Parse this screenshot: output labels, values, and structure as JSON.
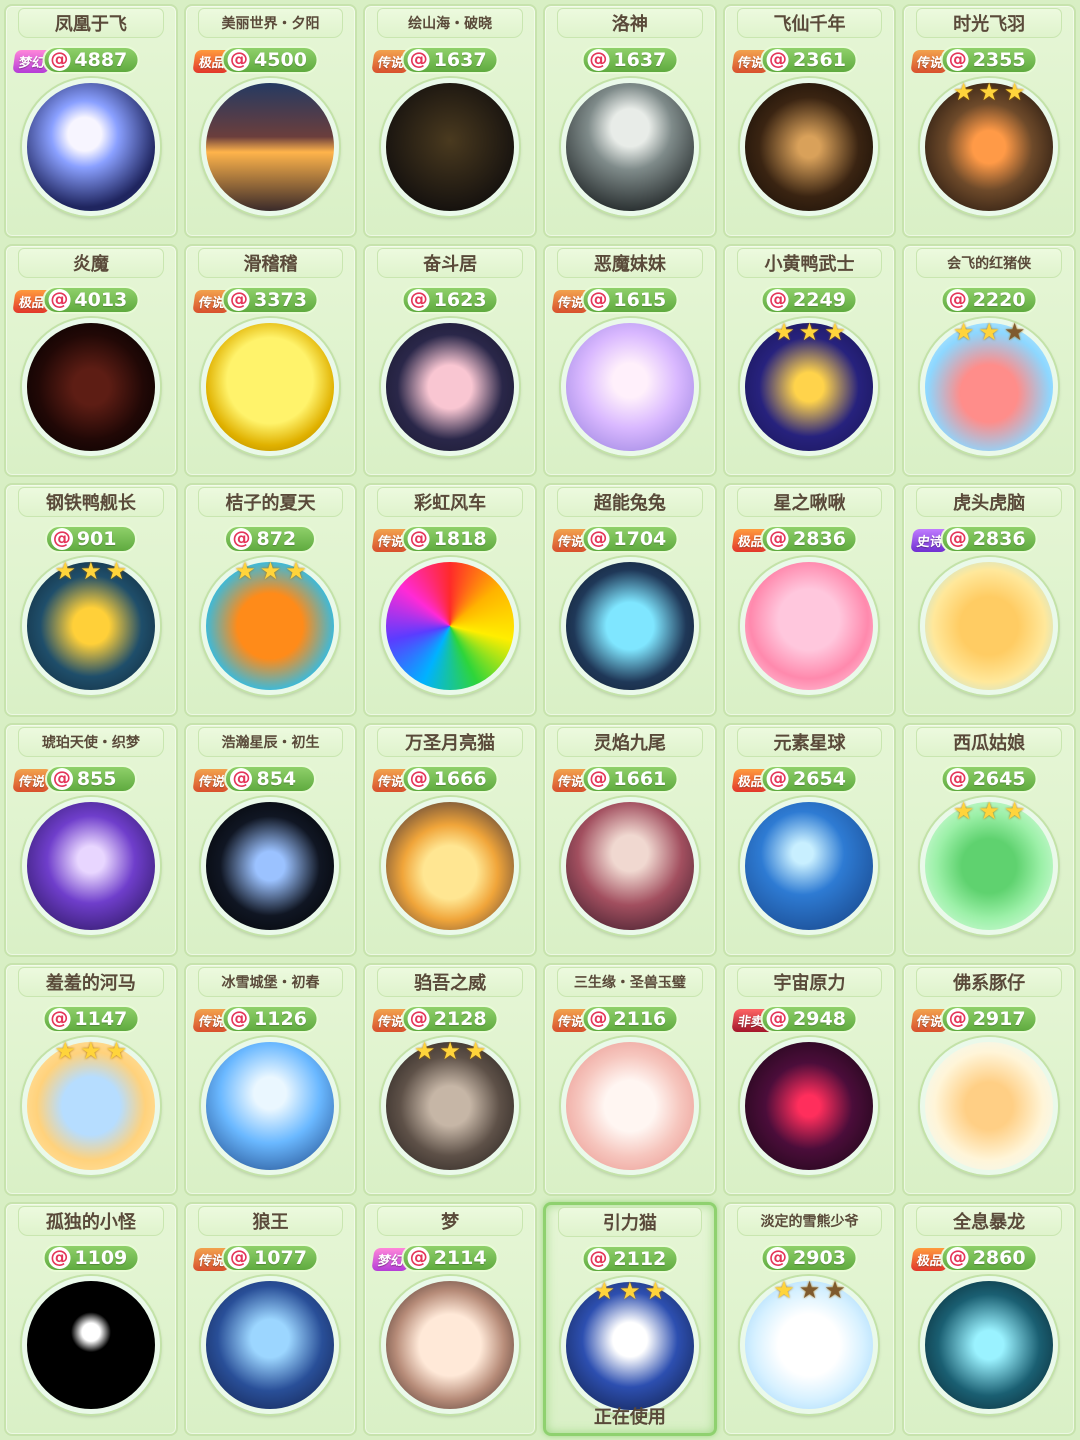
{
  "cards": [
    {
      "name": "凤凰于飞",
      "price": "4887",
      "rank": "梦幻",
      "rank_type": "dream",
      "stars": 0,
      "art": "phoenix"
    },
    {
      "name": "美丽世界・夕阳",
      "price": "4500",
      "rank": "极品",
      "rank_type": "ultra",
      "stars": 0,
      "art": "sunset"
    },
    {
      "name": "绘山海・破晓",
      "price": "1637",
      "rank": "传说",
      "rank_type": "legend",
      "stars": 0,
      "art": "mountain"
    },
    {
      "name": "洛神",
      "price": "1637",
      "rank": "",
      "rank_type": "",
      "stars": 0,
      "art": "goddess"
    },
    {
      "name": "飞仙千年",
      "price": "2361",
      "rank": "传说",
      "rank_type": "legend",
      "stars": 0,
      "art": "fairy"
    },
    {
      "name": "时光飞羽",
      "price": "2355",
      "rank": "传说",
      "rank_type": "legend",
      "stars": 3,
      "art": "owl"
    },
    {
      "name": "炎魔",
      "price": "4013",
      "rank": "极品",
      "rank_type": "ultra",
      "stars": 0,
      "art": "flame"
    },
    {
      "name": "滑稽稽",
      "price": "3373",
      "rank": "传说",
      "rank_type": "legend",
      "stars": 0,
      "art": "emoji"
    },
    {
      "name": "奋斗居",
      "price": "1623",
      "rank": "",
      "rank_type": "",
      "stars": 0,
      "art": "pig-study"
    },
    {
      "name": "恶魔妹妹",
      "price": "1615",
      "rank": "传说",
      "rank_type": "legend",
      "stars": 0,
      "art": "demon-girl"
    },
    {
      "name": "小黄鸭武士",
      "price": "2249",
      "rank": "",
      "rank_type": "",
      "stars": 3,
      "art": "duck-ninja"
    },
    {
      "name": "会飞的红猪侠",
      "price": "2220",
      "rank": "",
      "rank_type": "",
      "stars": 3,
      "stars_dim": 1,
      "art": "red-pig"
    },
    {
      "name": "钢铁鸭舰长",
      "price": "901",
      "rank": "",
      "rank_type": "",
      "stars": 3,
      "art": "iron-duck"
    },
    {
      "name": "桔子的夏天",
      "price": "872",
      "rank": "",
      "rank_type": "",
      "stars": 3,
      "art": "orange"
    },
    {
      "name": "彩虹风车",
      "price": "1818",
      "rank": "传说",
      "rank_type": "legend",
      "stars": 0,
      "art": "rainbow"
    },
    {
      "name": "超能兔兔",
      "price": "1704",
      "rank": "传说",
      "rank_type": "legend",
      "stars": 0,
      "art": "bunny"
    },
    {
      "name": "星之啾啾",
      "price": "2836",
      "rank": "极品",
      "rank_type": "ultra",
      "stars": 0,
      "art": "pink-blob"
    },
    {
      "name": "虎头虎脑",
      "price": "2836",
      "rank": "史诗",
      "rank_type": "epic",
      "stars": 0,
      "art": "tiger"
    },
    {
      "name": "琥珀天使・织梦",
      "price": "855",
      "rank": "传说",
      "rank_type": "legend",
      "stars": 0,
      "art": "galaxy-angel"
    },
    {
      "name": "浩瀚星辰・初生",
      "price": "854",
      "rank": "传说",
      "rank_type": "legend",
      "stars": 0,
      "art": "saturn"
    },
    {
      "name": "万圣月亮猫",
      "price": "1666",
      "rank": "传说",
      "rank_type": "legend",
      "stars": 0,
      "art": "moon-cat"
    },
    {
      "name": "灵焰九尾",
      "price": "1661",
      "rank": "传说",
      "rank_type": "legend",
      "stars": 0,
      "art": "nine-tail"
    },
    {
      "name": "元素星球",
      "price": "2654",
      "rank": "极品",
      "rank_type": "ultra",
      "stars": 0,
      "art": "ocean"
    },
    {
      "name": "西瓜姑娘",
      "price": "2645",
      "rank": "",
      "rank_type": "",
      "stars": 3,
      "art": "watermelon"
    },
    {
      "name": "羞羞的河马",
      "price": "1147",
      "rank": "",
      "rank_type": "",
      "stars": 3,
      "art": "hippo"
    },
    {
      "name": "冰雪城堡・初春",
      "price": "1126",
      "rank": "传说",
      "rank_type": "legend",
      "stars": 0,
      "art": "ice-castle"
    },
    {
      "name": "驺吾之威",
      "price": "2128",
      "rank": "传说",
      "rank_type": "legend",
      "stars": 3,
      "art": "beast"
    },
    {
      "name": "三生缘・圣兽玉璧",
      "price": "2116",
      "rank": "传说",
      "rank_type": "legend",
      "stars": 0,
      "art": "jade"
    },
    {
      "name": "宇宙原力",
      "price": "2948",
      "rank": "非卖品",
      "rank_type": "notsale",
      "stars": 0,
      "art": "cosmic"
    },
    {
      "name": "佛系豚仔",
      "price": "2917",
      "rank": "传说",
      "rank_type": "legend",
      "stars": 0,
      "art": "capybara"
    },
    {
      "name": "孤独的小怪",
      "price": "1109",
      "rank": "",
      "rank_type": "",
      "stars": 0,
      "art": "ghost"
    },
    {
      "name": "狼王",
      "price": "1077",
      "rank": "传说",
      "rank_type": "legend",
      "stars": 0,
      "art": "wolf"
    },
    {
      "name": "梦",
      "price": "2114",
      "rank": "梦幻",
      "rank_type": "dream",
      "stars": 0,
      "art": "dream"
    },
    {
      "name": "引力猫",
      "price": "2112",
      "rank": "",
      "rank_type": "",
      "stars": 3,
      "art": "gravity-cat",
      "selected": true,
      "status": "正在使用"
    },
    {
      "name": "淡定的雪熊少爷",
      "price": "2903",
      "rank": "",
      "rank_type": "",
      "stars": 3,
      "stars_dim": 2,
      "art": "snow-bear"
    },
    {
      "name": "全息暴龙",
      "price": "2860",
      "rank": "极品",
      "rank_type": "ultra",
      "stars": 0,
      "art": "hologram-dino"
    }
  ]
}
